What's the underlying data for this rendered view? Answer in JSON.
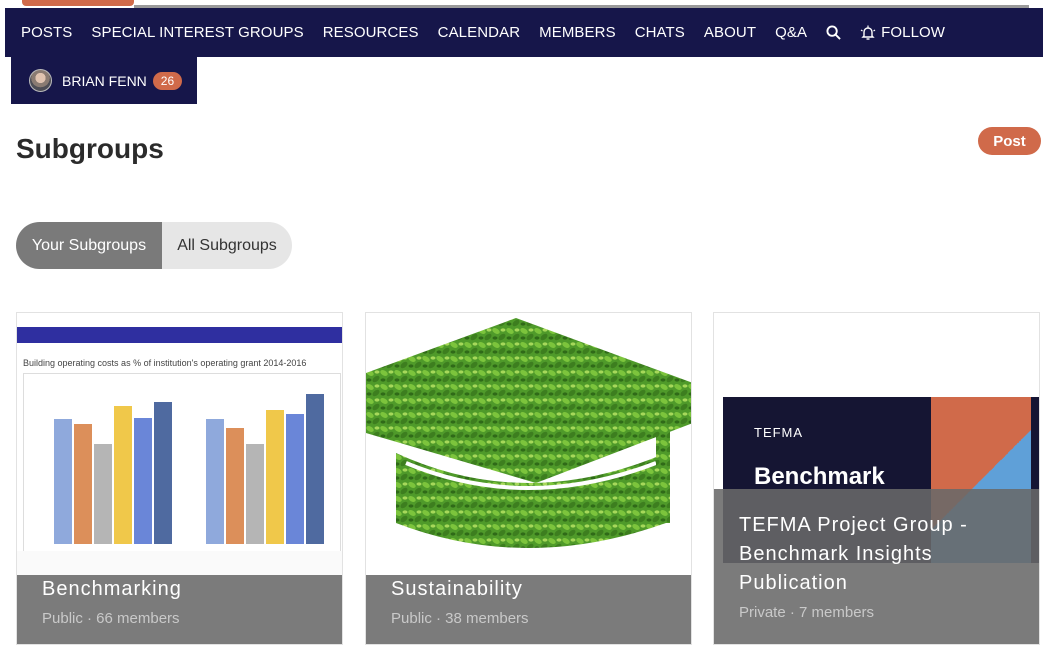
{
  "nav": {
    "items": [
      "POSTS",
      "SPECIAL INTEREST GROUPS",
      "RESOURCES",
      "CALENDAR",
      "MEMBERS",
      "CHATS",
      "ABOUT",
      "Q&A"
    ],
    "search_icon": "search-icon",
    "follow_icon": "bell-icon",
    "follow_label": "FOLLOW"
  },
  "user": {
    "name": "BRIAN FENN",
    "badge_count": "26"
  },
  "page": {
    "title": "Subgroups",
    "post_button": "Post"
  },
  "tabs": {
    "active": "Your Subgroups",
    "inactive": "All Subgroups"
  },
  "cards": [
    {
      "title": "Benchmarking",
      "meta": "Public · 66 members",
      "image_caption": "Building operating costs as % of institution's operating grant 2014-2016"
    },
    {
      "title": "Sustainability",
      "meta": "Public · 38 members"
    },
    {
      "title": "TEFMA Project Group - Benchmark Insights Publication",
      "meta": "Private · 7 members",
      "image_logo": "TEFMA",
      "image_heading": "Benchmark"
    }
  ],
  "colors": {
    "nav_bg": "#16164a",
    "accent": "#d06a4a",
    "overlay": "#696969"
  }
}
